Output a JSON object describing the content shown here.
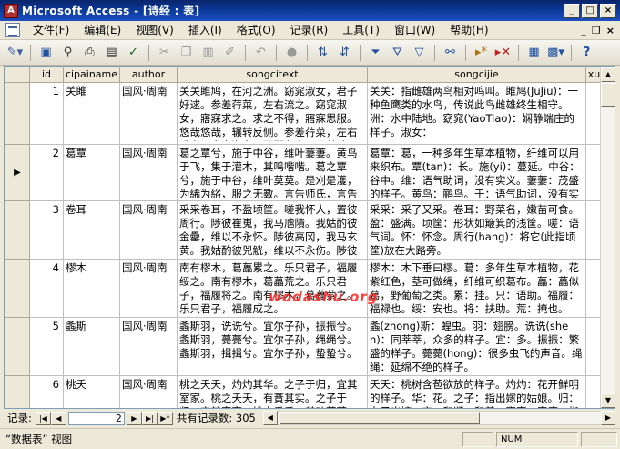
{
  "window": {
    "title": "Microsoft Access - [诗经 : 表]",
    "app_icon_label": "A",
    "btn_minimize": "_",
    "btn_maximize": "□",
    "btn_close": "×"
  },
  "menu": {
    "items": [
      {
        "label": "文件(F)"
      },
      {
        "label": "编辑(E)"
      },
      {
        "label": "视图(V)"
      },
      {
        "label": "插入(I)"
      },
      {
        "label": "格式(O)"
      },
      {
        "label": "记录(R)"
      },
      {
        "label": "工具(T)"
      },
      {
        "label": "窗口(W)"
      },
      {
        "label": "帮助(H)"
      }
    ],
    "doc_minimize": "_",
    "doc_restore": "❐",
    "doc_close": "×"
  },
  "toolbar": {
    "icons": [
      "view-icon",
      "save-icon",
      "search-file-icon",
      "print-icon",
      "print-preview-icon",
      "spelling-icon",
      "cut-icon",
      "copy-icon",
      "paste-icon",
      "format-painter-icon",
      "undo-icon",
      "insert-hyperlink-icon",
      "sort-ascending-icon",
      "sort-descending-icon",
      "filter-by-selection-icon",
      "filter-by-form-icon",
      "apply-filter-icon",
      "find-icon",
      "new-record-icon",
      "delete-record-icon",
      "database-window-icon",
      "new-object-icon",
      "help-icon"
    ]
  },
  "table": {
    "columns": [
      "id",
      "cipainame",
      "author",
      "songcitext",
      "songcijie",
      "xu"
    ],
    "selected_row_marker": "▶",
    "rows": [
      {
        "id": "1",
        "cipainame": "关雎",
        "author": "国风·周南",
        "songcitext": "关关雎鸠，在河之洲。窈窕淑女，君子好逑。参差荇菜，左右流之。窈窕淑女，寤寐求之。求之不得，寤寐思服。悠哉悠哉，辗转反侧。参差荇菜，左右采之。窈窕淑女，琴瑟友之。参差荇菜，左右芼之。窈窕淑女，钟鼓乐之。",
        "songcijie": "关关：指雌雄两鸟相对鸣叫。雎鸠(JuJiu)：一种鱼鹰类的水鸟，传说此鸟雌雄终生相守。洲：水中陆地。窈窕(YaoTiao)：娴静端庄的样子。淑女：",
        "xu": ""
      },
      {
        "id": "2",
        "cipainame": "葛覃",
        "author": "国风·周南",
        "songcitext": "葛之覃兮，施于中谷，维叶萋萋。黄鸟于飞，集于灌木，其鸣喈喈。葛之覃兮，施于中谷，维叶莫莫。是刈是濩，为絺为綌，服之无斁。言告师氏，言告言归。薄污我私，薄浣我衣。害浣害否，归宁父母。",
        "songcijie": "葛覃：葛，一种多年生草本植物，纤维可以用来织布。覃(tan)：长。施(yi)：蔓延。中谷：谷中。维：语气助词，没有实义。萋萋：茂盛的样子。黄鸟：鹂鸟。于：语气助词，没有实义。",
        "xu": ""
      },
      {
        "id": "3",
        "cipainame": "卷耳",
        "author": "国风·周南",
        "songcitext": "采采卷耳，不盈顷筐。嗟我怀人，置彼周行。陟彼崔嵬，我马虺隤。我姑酌彼金罍，维以不永怀。陟彼高冈，我马玄黄。我姑酌彼兕觥，维以不永伤。陟彼砠矣，我马瘏矣，我仆痡矣，云何吁矣。",
        "songcijie": "采采：采了又采。卷耳：野菜名，嫩苗可食。盈：盛满。顷筐：形状如簸箕的浅筐。嗟：语气词。怀：怀念。周行(hang)：将它(此指顷筐)放在大路旁。",
        "xu": ""
      },
      {
        "id": "4",
        "cipainame": "樛木",
        "author": "国风·周南",
        "songcitext": "南有樛木，葛藟累之。乐只君子，福履绥之。南有樛木，葛藟荒之。乐只君子，福履将之。南有樛木，葛藟萦之。乐只君子，福履成之。",
        "songcijie": "樛木：木下垂曰樛。葛：多年生草本植物，花紫红色，茎可做绳，纤维可织葛布。藟：藟似葛，野葡萄之类。累：挂。只：语助。福履：福禄也。绥：安也。将：扶助。荒：掩也。萦：旋也。",
        "xu": ""
      },
      {
        "id": "5",
        "cipainame": "螽斯",
        "author": "国风·周南",
        "songcitext": "螽斯羽，诜诜兮。宜尔子孙，振振兮。螽斯羽，薨薨兮。宜尔子孙，绳绳兮。螽斯羽，揖揖兮。宜尔子孙，蛰蛰兮。",
        "songcijie": "螽(zhong)斯：蝗虫。羽：翅膀。诜诜(shen)：同莘莘，众多的样子。宜：多。振振：繁盛的样子。薨薨(hong)：很多虫飞的声音。绳绳：延绵不绝的样子。",
        "xu": ""
      },
      {
        "id": "6",
        "cipainame": "桃夭",
        "author": "国风·周南",
        "songcitext": "桃之夭夭，灼灼其华。之子于归，宜其室家。桃之夭夭，有蕡其实。之子于归，宜其家室。桃之夭夭，其叶蓁蓁。之子于归，宜其家人。",
        "songcijie": "夭夭：桃树含苞欲放的样子。灼灼：花开鲜明的样子。华：花。之子：指出嫁的姑娘。归：女子出嫁。宜：和顺，和善。室家：家庭，指夫妇。",
        "xu": ""
      }
    ]
  },
  "navigation": {
    "label": "记录:",
    "current_record": "2",
    "total_label": "共有记录数: 305",
    "btn_first": "|◀",
    "btn_prev": "◀",
    "btn_next": "▶",
    "btn_last": "▶|",
    "btn_new": "▶*"
  },
  "watermark": "wodashu.org",
  "status": {
    "view": "“数据表” 视图",
    "num": "NUM"
  }
}
